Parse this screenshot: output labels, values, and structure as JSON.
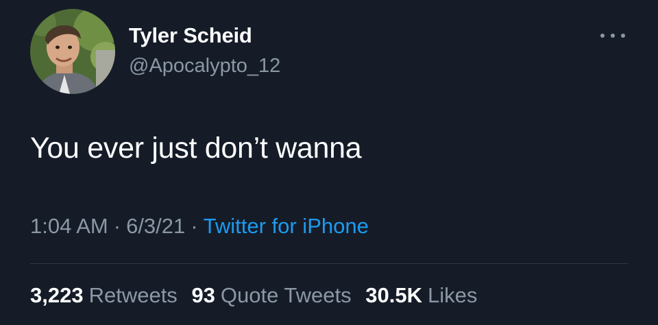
{
  "user": {
    "display_name": "Tyler Scheid",
    "handle": "@Apocalypto_12"
  },
  "tweet": {
    "text": "You ever just don’t wanna",
    "time": "1:04 AM",
    "date": "6/3/21",
    "separator": "·",
    "source": "Twitter for iPhone"
  },
  "stats": {
    "retweets_count": "3,223",
    "retweets_label": "Retweets",
    "quotes_count": "93",
    "quotes_label": "Quote Tweets",
    "likes_count": "30.5K",
    "likes_label": "Likes"
  },
  "colors": {
    "background": "#151c28",
    "primary_text": "#ffffff",
    "secondary_text": "#8b98a5",
    "link": "#1d9bf0"
  },
  "icons": {
    "more": "more-options-icon",
    "avatar": "profile-photo"
  }
}
